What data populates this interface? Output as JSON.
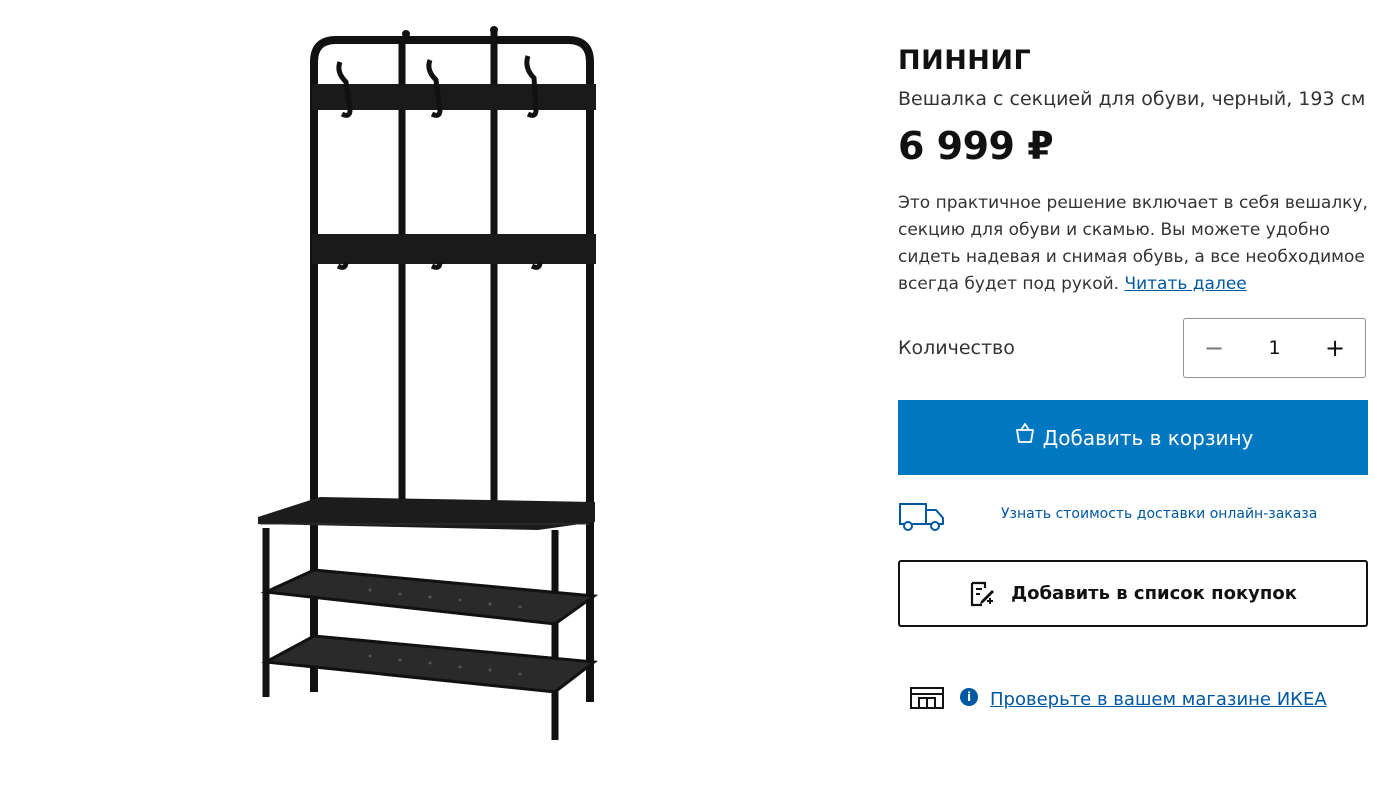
{
  "product": {
    "name": "ПИННИГ",
    "description": "Вешалка с секцией для обуви, черный, 193 см",
    "price": "6 999 ₽",
    "summary": "Это практичное решение включает в себя вешалку, секцию для обуви и скамью. Вы можете удобно сидеть надевая и снимая обувь, а все необходимое всегда будет под рукой.",
    "read_more": "Читать далее",
    "image_alt": "PINNIG coat rack with shoe storage bench, black"
  },
  "quantity": {
    "label": "Количество",
    "value": "1",
    "minus_symbol": "−",
    "plus_symbol": "+"
  },
  "actions": {
    "add_to_cart": "Добавить в корзину",
    "delivery_cost": "Узнать стоимость доставки онлайн-заказа",
    "add_to_list": "Добавить в список покупок",
    "check_store": "Проверьте в вашем магазине ИКЕА",
    "info_symbol": "i"
  },
  "colors": {
    "primary_blue": "#0077c1",
    "link_blue": "#0058a3",
    "text": "#111111"
  },
  "icons": [
    "shopping-bag-icon",
    "delivery-truck-icon",
    "shopping-list-icon",
    "store-icon",
    "info-icon"
  ]
}
